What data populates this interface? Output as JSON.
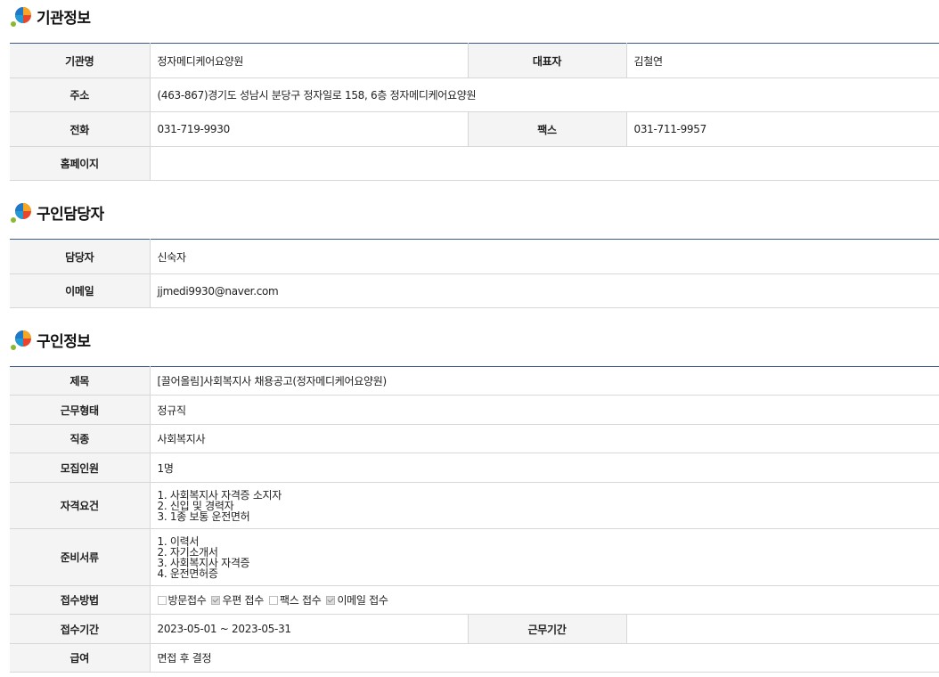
{
  "sections": {
    "institution": {
      "title": "기관정보",
      "rows": {
        "name_label": "기관명",
        "name_value": "정자메디케어요양원",
        "rep_label": "대표자",
        "rep_value": "김철연",
        "addr_label": "주소",
        "addr_value": "(463-867)경기도 성남시 분당구 정자일로 158, 6층 정자메디케어요양원",
        "phone_label": "전화",
        "phone_value": "031-719-9930",
        "fax_label": "팩스",
        "fax_value": "031-711-9957",
        "homepage_label": "홈페이지",
        "homepage_value": ""
      }
    },
    "contact": {
      "title": "구인담당자",
      "rows": {
        "manager_label": "담당자",
        "manager_value": "신숙자",
        "email_label": "이메일",
        "email_value": "jjmedi9930@naver.com"
      }
    },
    "job": {
      "title": "구인정보",
      "rows": {
        "subject_label": "제목",
        "subject_value": "[끌어올림]사회복지사 채용공고(정자메디케어요양원)",
        "worktype_label": "근무형태",
        "worktype_value": "정규직",
        "occupation_label": "직종",
        "occupation_value": "사회복지사",
        "headcount_label": "모집인원",
        "headcount_value": "1명",
        "qual_label": "자격요건",
        "qual_lines": [
          "1. 사회복지사 자격증 소지자",
          "2. 신입 및 경력자",
          "3. 1종 보통 운전면허"
        ],
        "docs_label": "준비서류",
        "docs_lines": [
          "1. 이력서",
          "2. 자기소개서",
          "3. 사회복지사 자격증",
          "4. 운전면허증"
        ],
        "apply_label": "접수방법",
        "apply_options": [
          {
            "label": "방문접수",
            "checked": false
          },
          {
            "label": "우편 접수",
            "checked": true
          },
          {
            "label": "팩스 접수",
            "checked": false
          },
          {
            "label": "이메일 접수",
            "checked": true
          }
        ],
        "period_label": "접수기간",
        "period_value": "2023-05-01 ~ 2023-05-31",
        "workperiod_label": "근무기간",
        "workperiod_value": "",
        "salary_label": "급여",
        "salary_value": "면접 후 결정"
      }
    }
  },
  "colors": {
    "accent_border": "#3a5a85",
    "header_bg": "#f4f4f4"
  },
  "icons": {
    "section_icon": "colored-ball-logo-icon"
  }
}
